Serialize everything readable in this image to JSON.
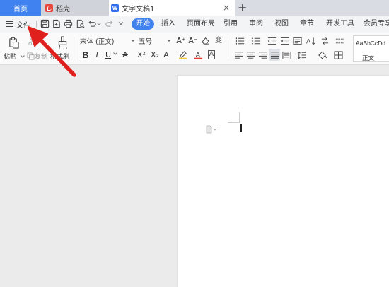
{
  "tabs": {
    "home": "首页",
    "docer": "稻壳",
    "document": "文字文稿1",
    "doc_icon_letter": "W",
    "close": "×",
    "new_tab": "+"
  },
  "menu": {
    "file": "文件",
    "tabs": [
      "开始",
      "插入",
      "页面布局",
      "引用",
      "审阅",
      "视图",
      "章节",
      "开发工具",
      "会员专享"
    ],
    "active_tab": "开始"
  },
  "ribbon": {
    "paste_label": "粘贴",
    "copy_label": "复制",
    "format_painter_label": "格式刷",
    "font_name": "宋体 (正文)",
    "font_size": "五号",
    "style_sample": "AaBbCcDd",
    "style_name": "正文",
    "bold": "B",
    "italic": "I",
    "underline": "U",
    "strike": "A",
    "superscript": "X²",
    "subscript": "X₂",
    "clear_format": "A",
    "font_color_letter": "A",
    "char_border_letter": "A",
    "grow_font": "A⁺",
    "shrink_font": "A⁻",
    "pinyin": "变",
    "font_color_hex": "#e03c31",
    "highlight_hex": "#f4d03f"
  },
  "colors": {
    "accent": "#3f82f0",
    "arrow": "#e0201c",
    "tabbar": "#d9dde3",
    "menubar": "#f3f4f6",
    "workspace": "#ebebeb"
  }
}
